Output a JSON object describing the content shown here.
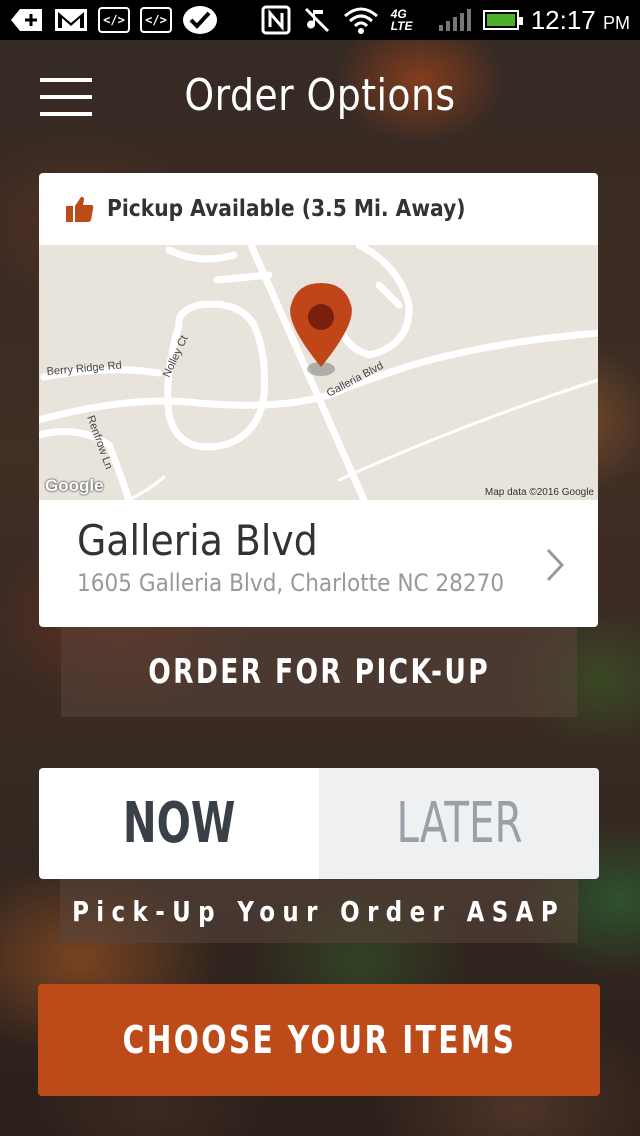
{
  "status_bar": {
    "time": "12:17",
    "ampm": "PM",
    "network": "4G LTE",
    "icons": [
      "add-icon",
      "gmail-icon",
      "code-icon",
      "code-icon",
      "check-icon",
      "nfc-icon",
      "mute-icon",
      "wifi-icon",
      "signal-icon",
      "battery-icon"
    ],
    "code_label": "</>"
  },
  "header": {
    "title": "Order Options"
  },
  "location_card": {
    "pickup_text": "Pickup Available (3.5 Mi. Away)",
    "store_name": "Galleria Blvd",
    "address": "1605 Galleria Blvd, Charlotte NC 28270",
    "map": {
      "labels": [
        "Berry Ridge Rd",
        "Nolley Ct",
        "Renfrow Ln",
        "Galleria Blvd"
      ],
      "credit": "Map data ©2016 Google",
      "logo": "Google"
    }
  },
  "buttons": {
    "order_pickup": "ORDER FOR PICK-UP",
    "choose_items": "CHOOSE YOUR ITEMS"
  },
  "time_toggle": {
    "now": "NOW",
    "later": "LATER",
    "selected": "NOW",
    "description": "Pick-Up Your Order ASAP"
  },
  "colors": {
    "accent": "#BD4A19",
    "pin": "#C0461A"
  }
}
